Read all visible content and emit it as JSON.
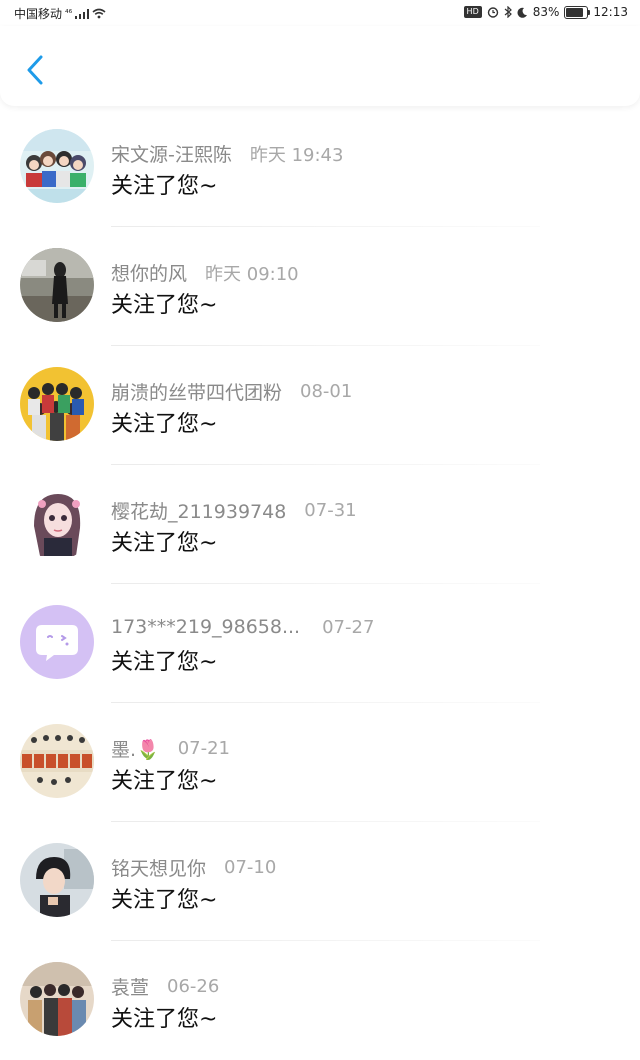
{
  "status_bar": {
    "carrier": "中国移动",
    "network": "⁴⁶",
    "hd": "HD",
    "battery": "83%",
    "time": "12:13",
    "battery_level": 0.83
  },
  "header": {
    "back_icon": "chevron-left-icon",
    "accent": "#1e9be9"
  },
  "notifications": [
    {
      "name": "宋文源-汪熙陈",
      "time": "昨天 19:43",
      "action": "关注了您~"
    },
    {
      "name": "想你的风",
      "time": "昨天 09:10",
      "action": "关注了您~"
    },
    {
      "name": "崩溃的丝带四代团粉",
      "time": "08-01",
      "action": "关注了您~"
    },
    {
      "name": "樱花劫_211939748",
      "time": "07-31",
      "action": "关注了您~"
    },
    {
      "name": "173***219_98658...",
      "time": "07-27",
      "action": "关注了您~"
    },
    {
      "name": "墨.🌷",
      "time": "07-21",
      "action": "关注了您~"
    },
    {
      "name": "铭天想见你",
      "time": "07-10",
      "action": "关注了您~"
    },
    {
      "name": "袁萱",
      "time": "06-26",
      "action": "关注了您~"
    }
  ]
}
